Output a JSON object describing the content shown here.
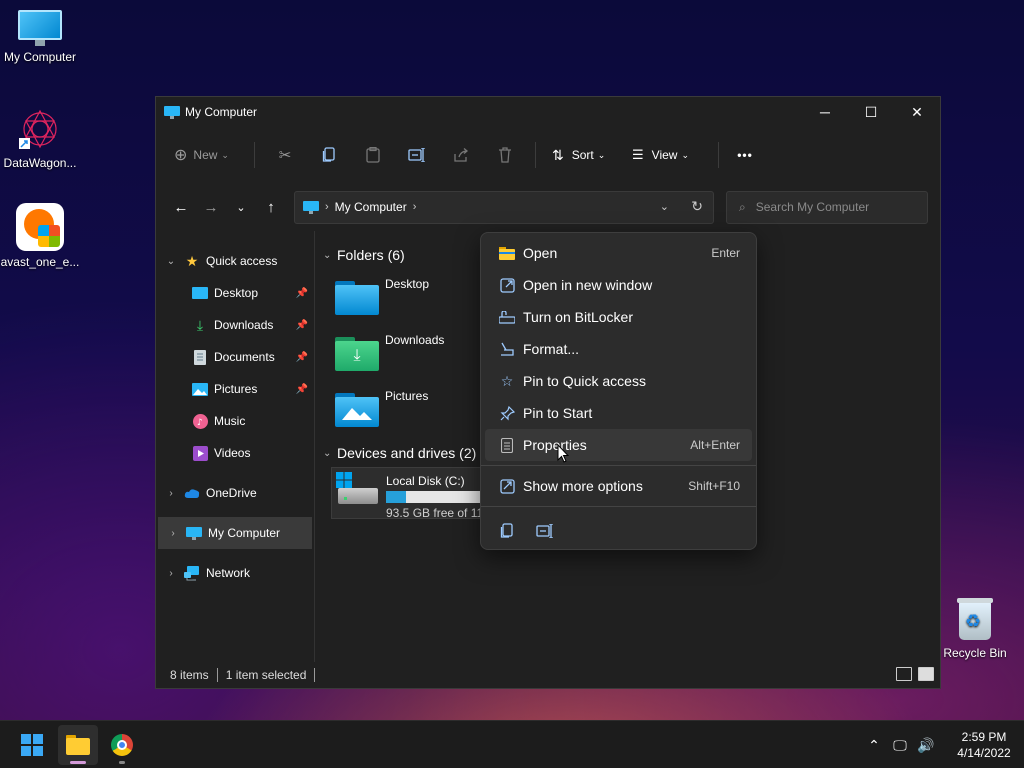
{
  "desktop": {
    "icons": [
      {
        "label": "My Computer"
      },
      {
        "label": "DataWagon..."
      },
      {
        "label": "avast_one_e..."
      },
      {
        "label": "Recycle Bin"
      }
    ]
  },
  "window": {
    "title": "My Computer",
    "controls": {
      "minimize": "─",
      "maximize": "☐",
      "close": "✕"
    },
    "commandbar": {
      "new_label": "New",
      "sort_label": "Sort",
      "view_label": "View",
      "more_label": "•••"
    },
    "address": {
      "path": "My Computer",
      "search_placeholder": "Search My Computer"
    },
    "sidebar": {
      "items": [
        {
          "label": "Quick access"
        },
        {
          "label": "Desktop"
        },
        {
          "label": "Downloads"
        },
        {
          "label": "Documents"
        },
        {
          "label": "Pictures"
        },
        {
          "label": "Music"
        },
        {
          "label": "Videos"
        },
        {
          "label": "OneDrive"
        },
        {
          "label": "My Computer"
        },
        {
          "label": "Network"
        }
      ]
    },
    "main": {
      "folders_header": "Folders (6)",
      "folders": [
        {
          "name": "Desktop"
        },
        {
          "name": "Downloads"
        },
        {
          "name": "Pictures"
        }
      ],
      "devices_header": "Devices and drives (2)",
      "drive": {
        "name": "Local Disk (C:)",
        "free_text": "93.5 GB free of 119 GB",
        "used_fraction": 0.21
      }
    },
    "status": {
      "items": "8 items",
      "selected": "1 item selected"
    }
  },
  "context_menu": {
    "items": [
      {
        "label": "Open",
        "shortcut": "Enter"
      },
      {
        "label": "Open in new window",
        "shortcut": ""
      },
      {
        "label": "Turn on BitLocker",
        "shortcut": ""
      },
      {
        "label": "Format...",
        "shortcut": ""
      },
      {
        "label": "Pin to Quick access",
        "shortcut": ""
      },
      {
        "label": "Pin to Start",
        "shortcut": ""
      },
      {
        "label": "Properties",
        "shortcut": "Alt+Enter"
      },
      {
        "label": "Show more options",
        "shortcut": "Shift+F10"
      }
    ]
  },
  "taskbar": {
    "time": "2:59 PM",
    "date": "4/14/2022"
  },
  "colors": {
    "accent": "#26a0da",
    "window_bg": "#202020",
    "menu_bg": "#2c2c2c"
  }
}
